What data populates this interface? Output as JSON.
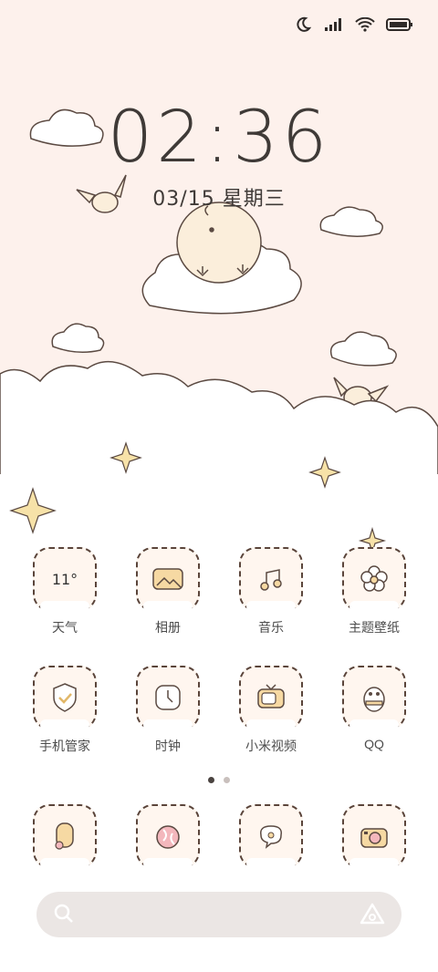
{
  "status_bar": {
    "icons": [
      "moon-icon",
      "signal-icon",
      "wifi-icon",
      "battery-icon"
    ]
  },
  "lock": {
    "time": "02:36",
    "date": "03/15 星期三"
  },
  "apps": [
    {
      "label": "天气",
      "icon": "weather-icon",
      "badge": "11°"
    },
    {
      "label": "相册",
      "icon": "gallery-icon"
    },
    {
      "label": "音乐",
      "icon": "music-icon"
    },
    {
      "label": "主题壁纸",
      "icon": "flower-icon"
    },
    {
      "label": "手机管家",
      "icon": "shield-icon"
    },
    {
      "label": "时钟",
      "icon": "clock-icon"
    },
    {
      "label": "小米视频",
      "icon": "tv-icon"
    },
    {
      "label": "QQ",
      "icon": "penguin-icon"
    }
  ],
  "dock": [
    "phone-icon",
    "browser-icon",
    "message-icon",
    "camera-icon"
  ],
  "pager": {
    "pages": 2,
    "active": 0
  },
  "search": {
    "left_icon": "search-icon",
    "right_icon": "assistant-icon"
  },
  "colors": {
    "background": "#fdf1ec",
    "cloud": "#ffffff",
    "rainbow_pink": "#f3b7bc",
    "rainbow_yellow": "#f7e0a4"
  }
}
